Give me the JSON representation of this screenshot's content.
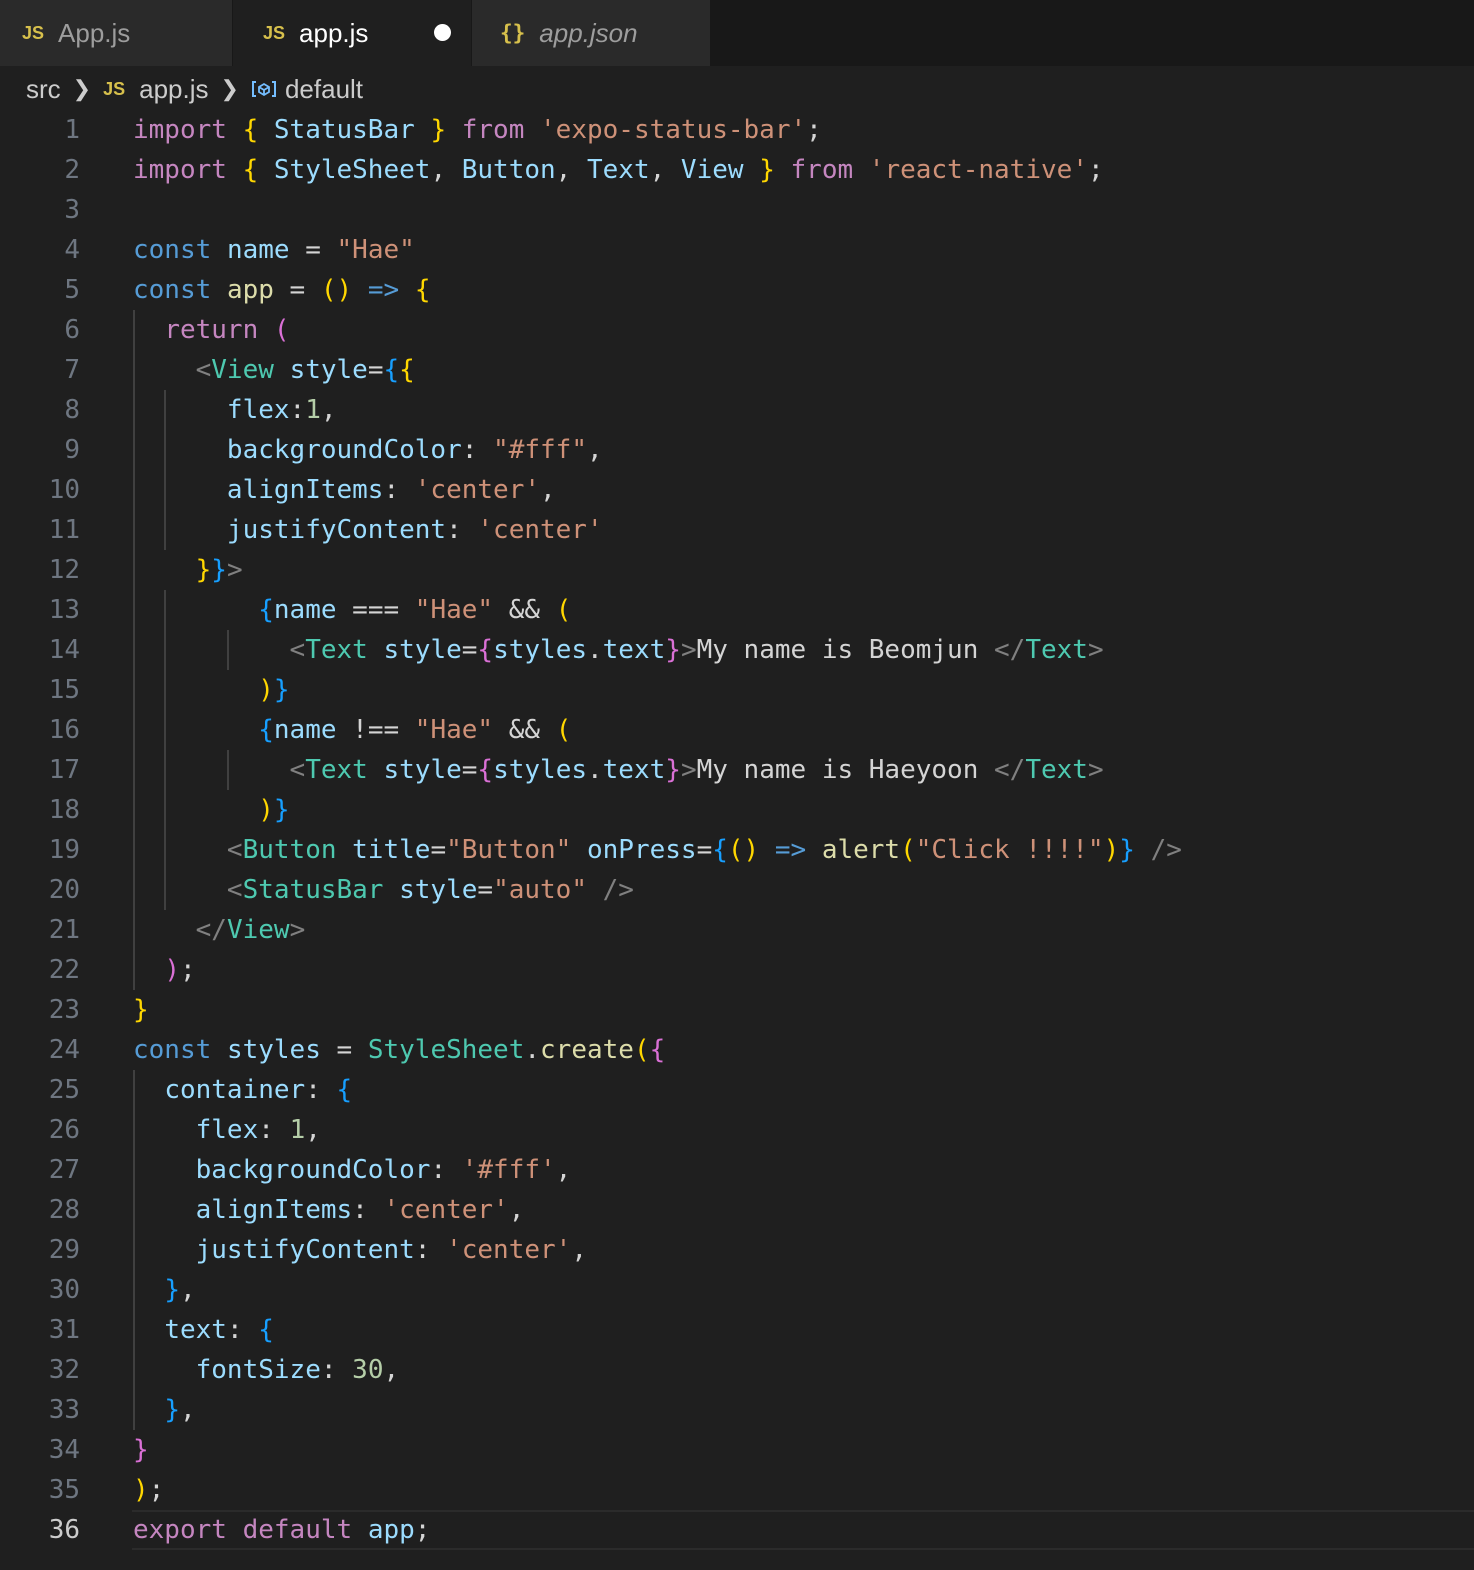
{
  "tabs": [
    {
      "icon": "JS",
      "label": "App.js",
      "active": false
    },
    {
      "icon": "JS",
      "label": "app.js",
      "active": true,
      "modified": true
    },
    {
      "icon": "{}",
      "label": "app.json",
      "active": false,
      "preview": true
    }
  ],
  "breadcrumb": {
    "folder": "src",
    "file_icon": "JS",
    "file": "app.js",
    "symbol": "default"
  },
  "editor": {
    "current_line": 36,
    "line_numbers": [
      "1",
      "2",
      "3",
      "4",
      "5",
      "6",
      "7",
      "8",
      "9",
      "10",
      "11",
      "12",
      "13",
      "14",
      "15",
      "16",
      "17",
      "18",
      "19",
      "20",
      "21",
      "22",
      "23",
      "24",
      "25",
      "26",
      "27",
      "28",
      "29",
      "30",
      "31",
      "32",
      "33",
      "34",
      "35",
      "36"
    ],
    "lines": [
      [
        [
          "kw",
          "import"
        ],
        [
          "op",
          " "
        ],
        [
          "b1",
          "{"
        ],
        [
          "op",
          " "
        ],
        [
          "var",
          "StatusBar"
        ],
        [
          "op",
          " "
        ],
        [
          "b1",
          "}"
        ],
        [
          "op",
          " "
        ],
        [
          "kw",
          "from"
        ],
        [
          "op",
          " "
        ],
        [
          "str",
          "'expo-status-bar'"
        ],
        [
          "op",
          ";"
        ]
      ],
      [
        [
          "kw",
          "import"
        ],
        [
          "op",
          " "
        ],
        [
          "b1",
          "{"
        ],
        [
          "op",
          " "
        ],
        [
          "var",
          "StyleSheet"
        ],
        [
          "op",
          ", "
        ],
        [
          "var",
          "Button"
        ],
        [
          "op",
          ", "
        ],
        [
          "var",
          "Text"
        ],
        [
          "op",
          ", "
        ],
        [
          "var",
          "View"
        ],
        [
          "op",
          " "
        ],
        [
          "b1",
          "}"
        ],
        [
          "op",
          " "
        ],
        [
          "kw",
          "from"
        ],
        [
          "op",
          " "
        ],
        [
          "str",
          "'react-native'"
        ],
        [
          "op",
          ";"
        ]
      ],
      [],
      [
        [
          "st",
          "const"
        ],
        [
          "op",
          " "
        ],
        [
          "var",
          "name"
        ],
        [
          "op",
          " = "
        ],
        [
          "str",
          "\"Hae\""
        ]
      ],
      [
        [
          "st",
          "const"
        ],
        [
          "op",
          " "
        ],
        [
          "fn",
          "app"
        ],
        [
          "op",
          " = "
        ],
        [
          "b1",
          "()"
        ],
        [
          "op",
          " "
        ],
        [
          "st",
          "=>"
        ],
        [
          "op",
          " "
        ],
        [
          "b1",
          "{"
        ]
      ],
      [
        [
          "op",
          "  "
        ],
        [
          "kw",
          "return"
        ],
        [
          "op",
          " "
        ],
        [
          "b2",
          "("
        ]
      ],
      [
        [
          "op",
          "    "
        ],
        [
          "pun",
          "<"
        ],
        [
          "tag",
          "View"
        ],
        [
          "op",
          " "
        ],
        [
          "var",
          "style"
        ],
        [
          "op",
          "="
        ],
        [
          "b3",
          "{"
        ],
        [
          "b1",
          "{"
        ]
      ],
      [
        [
          "op",
          "      "
        ],
        [
          "var",
          "flex"
        ],
        [
          "op",
          ":"
        ],
        [
          "num",
          "1"
        ],
        [
          "op",
          ","
        ]
      ],
      [
        [
          "op",
          "      "
        ],
        [
          "var",
          "backgroundColor"
        ],
        [
          "op",
          ": "
        ],
        [
          "str",
          "\"#fff\""
        ],
        [
          "op",
          ","
        ]
      ],
      [
        [
          "op",
          "      "
        ],
        [
          "var",
          "alignItems"
        ],
        [
          "op",
          ": "
        ],
        [
          "str",
          "'center'"
        ],
        [
          "op",
          ","
        ]
      ],
      [
        [
          "op",
          "      "
        ],
        [
          "var",
          "justifyContent"
        ],
        [
          "op",
          ": "
        ],
        [
          "str",
          "'center'"
        ]
      ],
      [
        [
          "op",
          "    "
        ],
        [
          "b1",
          "}"
        ],
        [
          "b3",
          "}"
        ],
        [
          "pun",
          ">"
        ]
      ],
      [
        [
          "op",
          "        "
        ],
        [
          "b3",
          "{"
        ],
        [
          "var",
          "name"
        ],
        [
          "op",
          " === "
        ],
        [
          "str",
          "\"Hae\""
        ],
        [
          "op",
          " && "
        ],
        [
          "b1",
          "("
        ]
      ],
      [
        [
          "op",
          "          "
        ],
        [
          "pun",
          "<"
        ],
        [
          "tag",
          "Text"
        ],
        [
          "op",
          " "
        ],
        [
          "var",
          "style"
        ],
        [
          "op",
          "="
        ],
        [
          "b2",
          "{"
        ],
        [
          "var",
          "styles"
        ],
        [
          "op",
          "."
        ],
        [
          "var",
          "text"
        ],
        [
          "b2",
          "}"
        ],
        [
          "pun",
          ">"
        ],
        [
          "txt",
          "My name is Beomjun "
        ],
        [
          "pun",
          "</"
        ],
        [
          "tag",
          "Text"
        ],
        [
          "pun",
          ">"
        ]
      ],
      [
        [
          "op",
          "        "
        ],
        [
          "b1",
          ")"
        ],
        [
          "b3",
          "}"
        ]
      ],
      [
        [
          "op",
          "        "
        ],
        [
          "b3",
          "{"
        ],
        [
          "var",
          "name"
        ],
        [
          "op",
          " !== "
        ],
        [
          "str",
          "\"Hae\""
        ],
        [
          "op",
          " && "
        ],
        [
          "b1",
          "("
        ]
      ],
      [
        [
          "op",
          "          "
        ],
        [
          "pun",
          "<"
        ],
        [
          "tag",
          "Text"
        ],
        [
          "op",
          " "
        ],
        [
          "var",
          "style"
        ],
        [
          "op",
          "="
        ],
        [
          "b2",
          "{"
        ],
        [
          "var",
          "styles"
        ],
        [
          "op",
          "."
        ],
        [
          "var",
          "text"
        ],
        [
          "b2",
          "}"
        ],
        [
          "pun",
          ">"
        ],
        [
          "txt",
          "My name is Haeyoon "
        ],
        [
          "pun",
          "</"
        ],
        [
          "tag",
          "Text"
        ],
        [
          "pun",
          ">"
        ]
      ],
      [
        [
          "op",
          "        "
        ],
        [
          "b1",
          ")"
        ],
        [
          "b3",
          "}"
        ]
      ],
      [
        [
          "op",
          "      "
        ],
        [
          "pun",
          "<"
        ],
        [
          "tag",
          "Button"
        ],
        [
          "op",
          " "
        ],
        [
          "var",
          "title"
        ],
        [
          "op",
          "="
        ],
        [
          "str",
          "\"Button\""
        ],
        [
          "op",
          " "
        ],
        [
          "var",
          "onPress"
        ],
        [
          "op",
          "="
        ],
        [
          "b3",
          "{"
        ],
        [
          "b1",
          "()"
        ],
        [
          "op",
          " "
        ],
        [
          "st",
          "=>"
        ],
        [
          "op",
          " "
        ],
        [
          "fn",
          "alert"
        ],
        [
          "b1",
          "("
        ],
        [
          "str",
          "\"Click !!!!\""
        ],
        [
          "b1",
          ")"
        ],
        [
          "b3",
          "}"
        ],
        [
          "op",
          " "
        ],
        [
          "pun",
          "/>"
        ]
      ],
      [
        [
          "op",
          "      "
        ],
        [
          "pun",
          "<"
        ],
        [
          "tag",
          "StatusBar"
        ],
        [
          "op",
          " "
        ],
        [
          "var",
          "style"
        ],
        [
          "op",
          "="
        ],
        [
          "str",
          "\"auto\""
        ],
        [
          "op",
          " "
        ],
        [
          "pun",
          "/>"
        ]
      ],
      [
        [
          "op",
          "    "
        ],
        [
          "pun",
          "</"
        ],
        [
          "tag",
          "View"
        ],
        [
          "pun",
          ">"
        ]
      ],
      [
        [
          "op",
          "  "
        ],
        [
          "b2",
          ")"
        ],
        [
          "op",
          ";"
        ]
      ],
      [
        [
          "b1",
          "}"
        ]
      ],
      [
        [
          "st",
          "const"
        ],
        [
          "op",
          " "
        ],
        [
          "var",
          "styles"
        ],
        [
          "op",
          " = "
        ],
        [
          "ty",
          "StyleSheet"
        ],
        [
          "op",
          "."
        ],
        [
          "fn",
          "create"
        ],
        [
          "b1",
          "("
        ],
        [
          "b2",
          "{"
        ]
      ],
      [
        [
          "op",
          "  "
        ],
        [
          "var",
          "container"
        ],
        [
          "op",
          ": "
        ],
        [
          "b3",
          "{"
        ]
      ],
      [
        [
          "op",
          "    "
        ],
        [
          "var",
          "flex"
        ],
        [
          "op",
          ": "
        ],
        [
          "num",
          "1"
        ],
        [
          "op",
          ","
        ]
      ],
      [
        [
          "op",
          "    "
        ],
        [
          "var",
          "backgroundColor"
        ],
        [
          "op",
          ": "
        ],
        [
          "str",
          "'#fff'"
        ],
        [
          "op",
          ","
        ]
      ],
      [
        [
          "op",
          "    "
        ],
        [
          "var",
          "alignItems"
        ],
        [
          "op",
          ": "
        ],
        [
          "str",
          "'center'"
        ],
        [
          "op",
          ","
        ]
      ],
      [
        [
          "op",
          "    "
        ],
        [
          "var",
          "justifyContent"
        ],
        [
          "op",
          ": "
        ],
        [
          "str",
          "'center'"
        ],
        [
          "op",
          ","
        ]
      ],
      [
        [
          "op",
          "  "
        ],
        [
          "b3",
          "}"
        ],
        [
          "op",
          ","
        ]
      ],
      [
        [
          "op",
          "  "
        ],
        [
          "var",
          "text"
        ],
        [
          "op",
          ": "
        ],
        [
          "b3",
          "{"
        ]
      ],
      [
        [
          "op",
          "    "
        ],
        [
          "var",
          "fontSize"
        ],
        [
          "op",
          ": "
        ],
        [
          "num",
          "30"
        ],
        [
          "op",
          ","
        ]
      ],
      [
        [
          "op",
          "  "
        ],
        [
          "b3",
          "}"
        ],
        [
          "op",
          ","
        ]
      ],
      [
        [
          "b2",
          "}"
        ]
      ],
      [
        [
          "b1",
          ")"
        ],
        [
          "op",
          ";"
        ]
      ],
      [
        [
          "kw",
          "export"
        ],
        [
          "op",
          " "
        ],
        [
          "kw",
          "default"
        ],
        [
          "op",
          " "
        ],
        [
          "var",
          "app"
        ],
        [
          "op",
          ";"
        ]
      ]
    ]
  }
}
